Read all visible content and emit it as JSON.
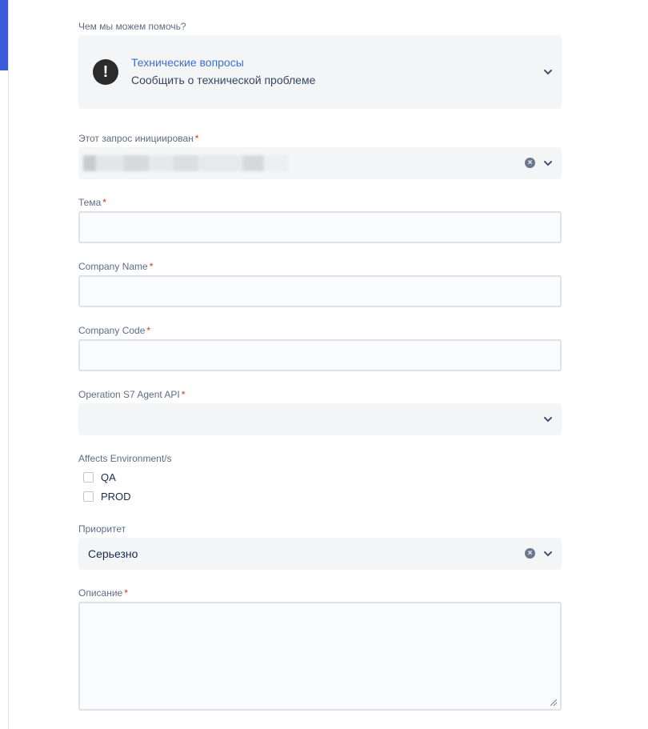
{
  "request_type": {
    "label": "Чем мы можем помочь?",
    "title": "Технические вопросы",
    "description": "Сообщить о технической проблеме",
    "icon": "exclamation-icon"
  },
  "initiator": {
    "label": "Этот запрос инициирован",
    "required_mark": "*"
  },
  "subject": {
    "label": "Тема",
    "required_mark": "*",
    "value": ""
  },
  "company_name": {
    "label": "Company Name",
    "required_mark": "*",
    "value": ""
  },
  "company_code": {
    "label": "Company Code",
    "required_mark": "*",
    "value": ""
  },
  "operation": {
    "label": "Operation S7 Agent API",
    "required_mark": "*",
    "value": ""
  },
  "environments": {
    "label": "Affects Environment/s",
    "options": [
      {
        "label": "QA",
        "checked": false
      },
      {
        "label": "PROD",
        "checked": false
      }
    ]
  },
  "priority": {
    "label": "Приоритет",
    "value": "Серьезно"
  },
  "description": {
    "label": "Описание",
    "required_mark": "*",
    "value": ""
  },
  "colors": {
    "accent": "#3b5bdb",
    "link": "#3b6fd4",
    "required": "#de350b",
    "field_bg": "#f4f5f7"
  }
}
